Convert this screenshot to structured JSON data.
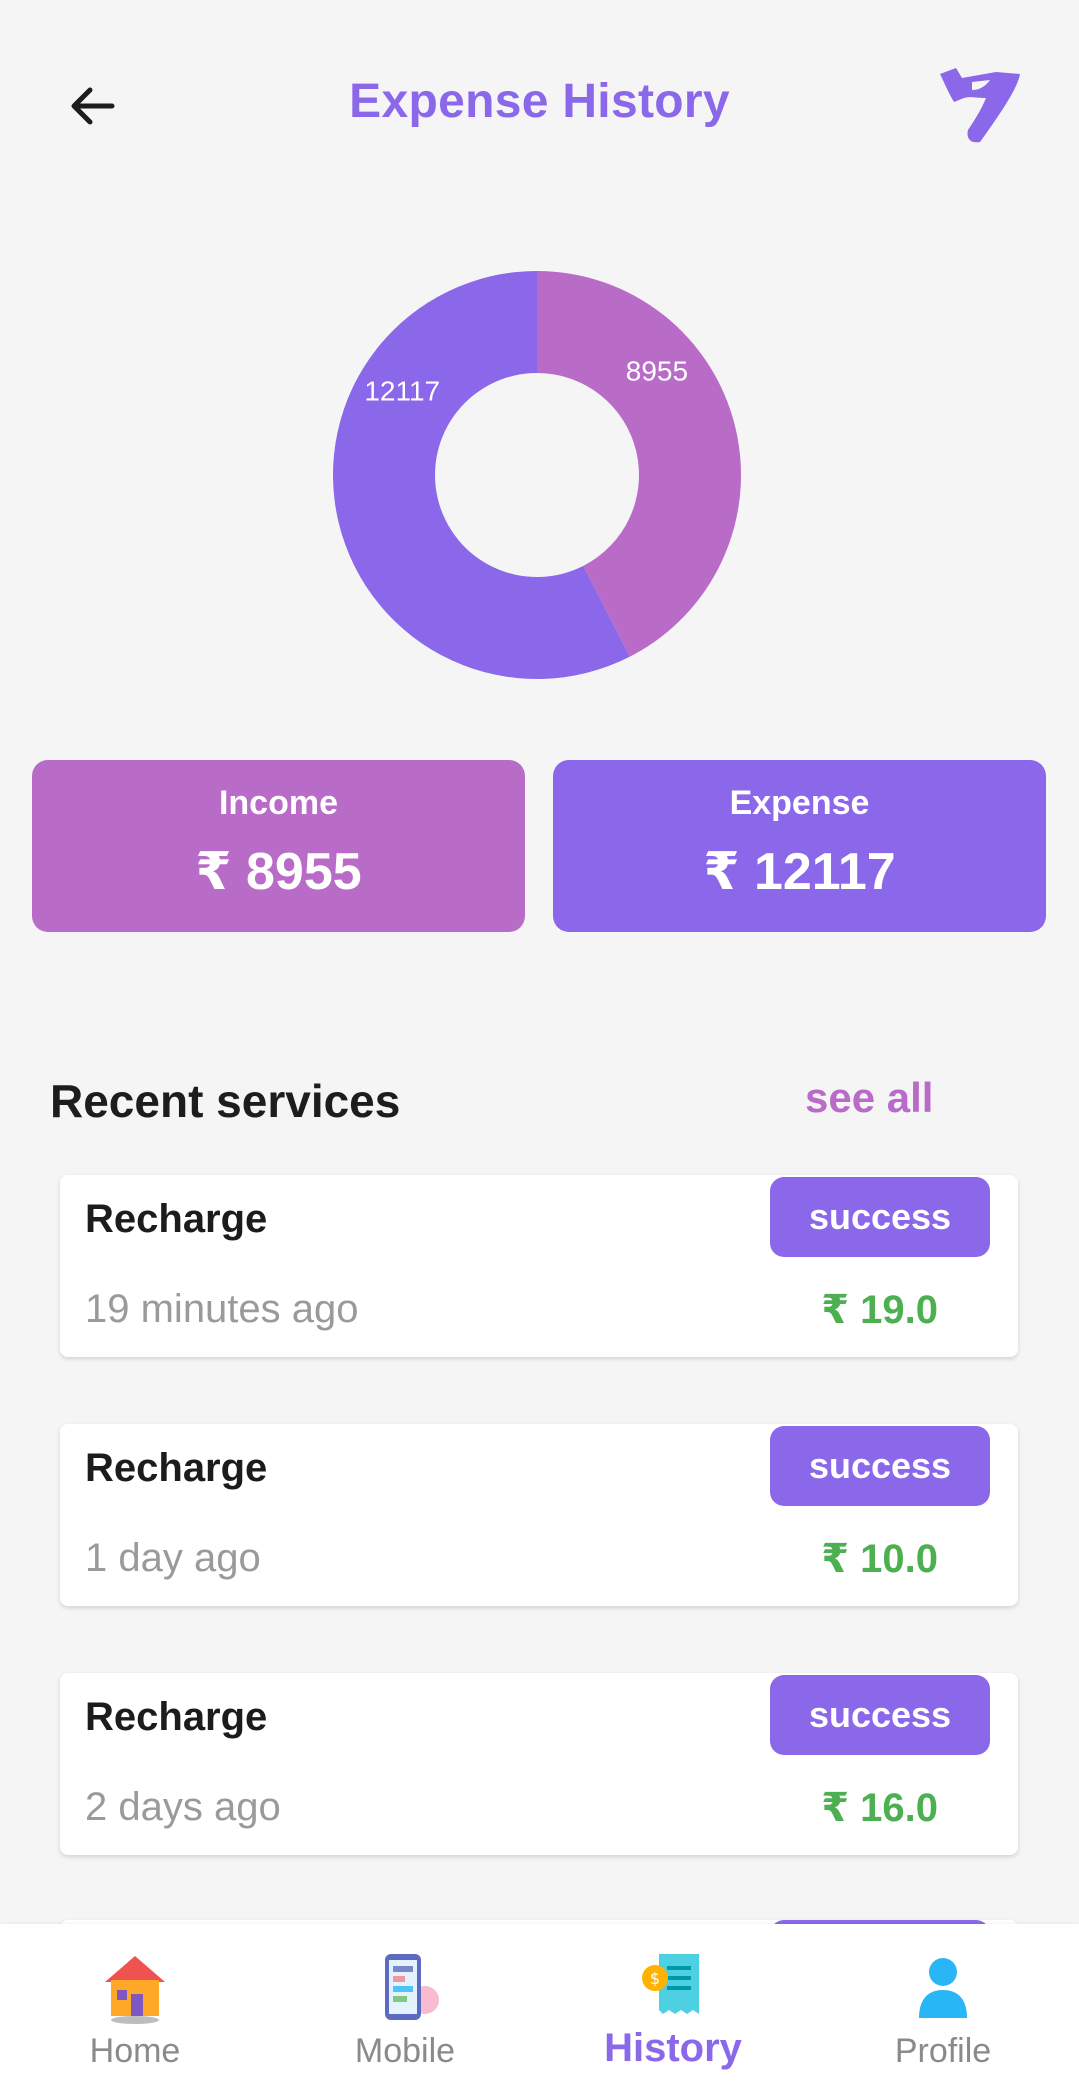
{
  "header": {
    "title": "Expense History"
  },
  "chart_data": {
    "type": "pie",
    "donut": true,
    "slices": [
      {
        "label": "8955",
        "value": 8955,
        "color": "#b96bc8"
      },
      {
        "label": "12117",
        "value": 12117,
        "color": "#8b67ea"
      }
    ]
  },
  "summary": {
    "income": {
      "label": "Income",
      "value": "₹ 8955",
      "color": "#b96bc8"
    },
    "expense": {
      "label": "Expense",
      "value": "₹ 12117",
      "color": "#8b67ea"
    }
  },
  "recent": {
    "title": "Recent services",
    "see_all": "see all",
    "items": [
      {
        "name": "Recharge",
        "time": "19 minutes ago",
        "status": "success",
        "amount": "₹ 19.0"
      },
      {
        "name": "Recharge",
        "time": "1 day ago",
        "status": "success",
        "amount": "₹ 10.0"
      },
      {
        "name": "Recharge",
        "time": "2 days ago",
        "status": "success",
        "amount": "₹ 16.0"
      }
    ]
  },
  "nav": {
    "items": [
      {
        "label": "Home",
        "icon": "home-icon"
      },
      {
        "label": "Mobile",
        "icon": "mobile-icon"
      },
      {
        "label": "History",
        "icon": "history-icon",
        "active": true
      },
      {
        "label": "Profile",
        "icon": "profile-icon"
      }
    ]
  },
  "colors": {
    "accent": "#8b67ea",
    "secondary": "#b96bc8",
    "positive": "#4caf50"
  }
}
